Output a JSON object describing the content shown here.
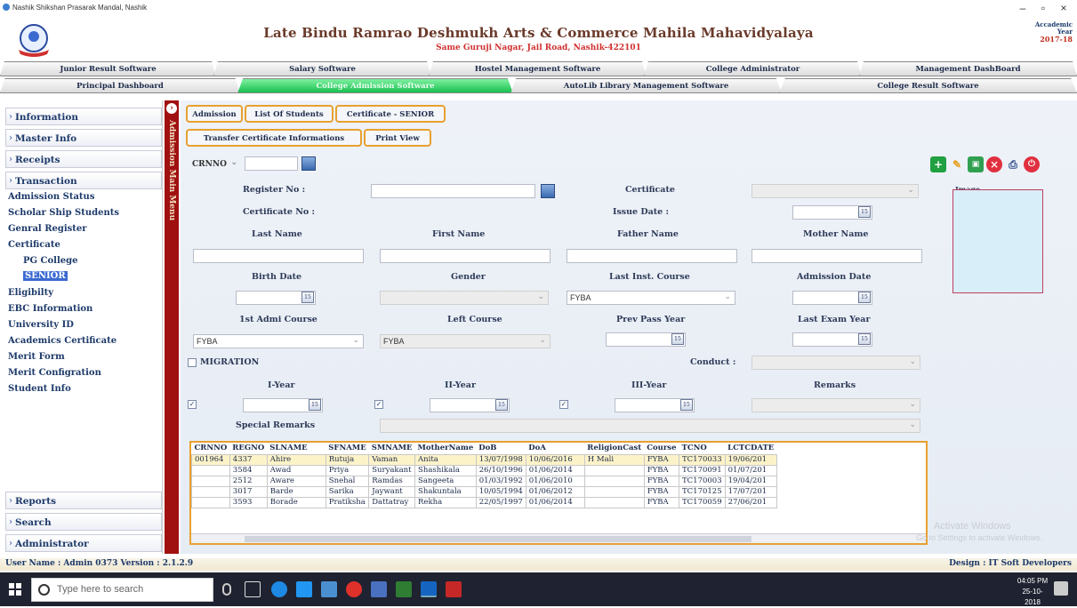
{
  "window": {
    "title": "Nashik Shikshan Prasarak Mandal, Nashik"
  },
  "header": {
    "college_name": "Late Bindu Ramrao Deshmukh Arts & Commerce Mahila Mahavidyalaya",
    "address": "Same Guruji Nagar, Jail Road, Nashik-422101",
    "academic_label": "Accademic",
    "year_label": "Year",
    "year_value": "2017-18"
  },
  "top_tabs": {
    "row1": [
      "Junior Result Software",
      "Salary Software",
      "Hostel Management Software",
      "College Administrator",
      "Management DashBoard"
    ],
    "row2": [
      "Principal Dashboard",
      "College Admission Software",
      "AutoLib Library Management Software",
      "College Result Software"
    ]
  },
  "nav": {
    "information": "Information",
    "master_info": "Master Info",
    "receipts": "Receipts",
    "transaction": "Transaction",
    "items": [
      "Admission Status",
      "Scholar Ship Students",
      "Genral Register",
      "Certificate",
      "PG College",
      "SENIOR",
      "Eligibilty",
      "EBC Information",
      "University ID",
      "Academics Certificate",
      "Merit Form",
      "Merit Configration",
      "Student Info"
    ],
    "reports": "Reports",
    "search": "Search",
    "administrator": "Administrator"
  },
  "vertical_menu": {
    "label": "Admission Main Menu"
  },
  "sub_tabs": {
    "row1": [
      "Admission",
      "List Of Students",
      "Certificate - SENIOR"
    ],
    "row2": [
      "Transfer Certificate Informations",
      "Print View"
    ]
  },
  "form": {
    "crnno_label": "CRNNO",
    "register_no": "Register No :",
    "certificate": "Certificate",
    "certificate_no": "Certificate No :",
    "issue_date": "Issue Date :",
    "last_name": "Last Name",
    "first_name": "First Name",
    "father_name": "Father Name",
    "mother_name": "Mother Name",
    "birth_date": "Birth Date",
    "gender": "Gender",
    "last_inst_course": "Last Inst. Course",
    "admission_date": "Admission Date",
    "last_inst_course_value": "FYBA",
    "first_admi_course": "1st Admi Course",
    "left_course": "Left Course",
    "prev_pass_year": "Prev Pass Year",
    "last_exam_year": "Last Exam Year",
    "first_admi_course_value": "FYBA",
    "left_course_value": "FYBA",
    "migration": "MIGRATION",
    "conduct": "Conduct :",
    "i_year": "I-Year",
    "ii_year": "II-Year",
    "iii_year": "III-Year",
    "remarks": "Remarks",
    "special_remarks": "Special Remarks",
    "image_label": "Image"
  },
  "grid": {
    "columns": [
      "CRNNO",
      "REGNO",
      "SLNAME",
      "SFNAME",
      "SMNAME",
      "MotherName",
      "DoB",
      "DoA",
      "ReligionCast",
      "Course",
      "TCNO",
      "LCTCDATE"
    ],
    "rows": [
      [
        "001964",
        "4337",
        "Ahire",
        "Rutuja",
        "Vaman",
        "Anita",
        "13/07/1998",
        "10/06/2016",
        "H Mali",
        "FYBA",
        "TC170033",
        "19/06/201"
      ],
      [
        "",
        "3584",
        "Awad",
        "Priya",
        "Suryakant",
        "Shashikala",
        "26/10/1996",
        "01/06/2014",
        "",
        "FYBA",
        "TC170091",
        "01/07/201"
      ],
      [
        "",
        "2512",
        "Aware",
        "Snehal",
        "Ramdas",
        "Sangeeta",
        "01/03/1992",
        "01/06/2010",
        "",
        "FYBA",
        "TC170003",
        "19/04/201"
      ],
      [
        "",
        "3017",
        "Barde",
        "Sarika",
        "Jaywant",
        "Shakuntala",
        "10/05/1994",
        "01/06/2012",
        "",
        "FYBA",
        "TC170125",
        "17/07/201"
      ],
      [
        "",
        "3593",
        "Borade",
        "Pratiksha",
        "Dattatray",
        "Rekha",
        "22/05/1997",
        "01/06/2014",
        "",
        "FYBA",
        "TC170059",
        "27/06/201"
      ]
    ]
  },
  "statusbar": {
    "left": "User Name : Admin 0373 Version : 2.1.2.9",
    "right": "Design : IT Soft Developers"
  },
  "watermark": {
    "line1": "Activate Windows",
    "line2": "Go to Settings to activate Windows."
  },
  "taskbar": {
    "search_placeholder": "Type here to search",
    "time": "04:05 PM",
    "date": "25-10-2018"
  }
}
